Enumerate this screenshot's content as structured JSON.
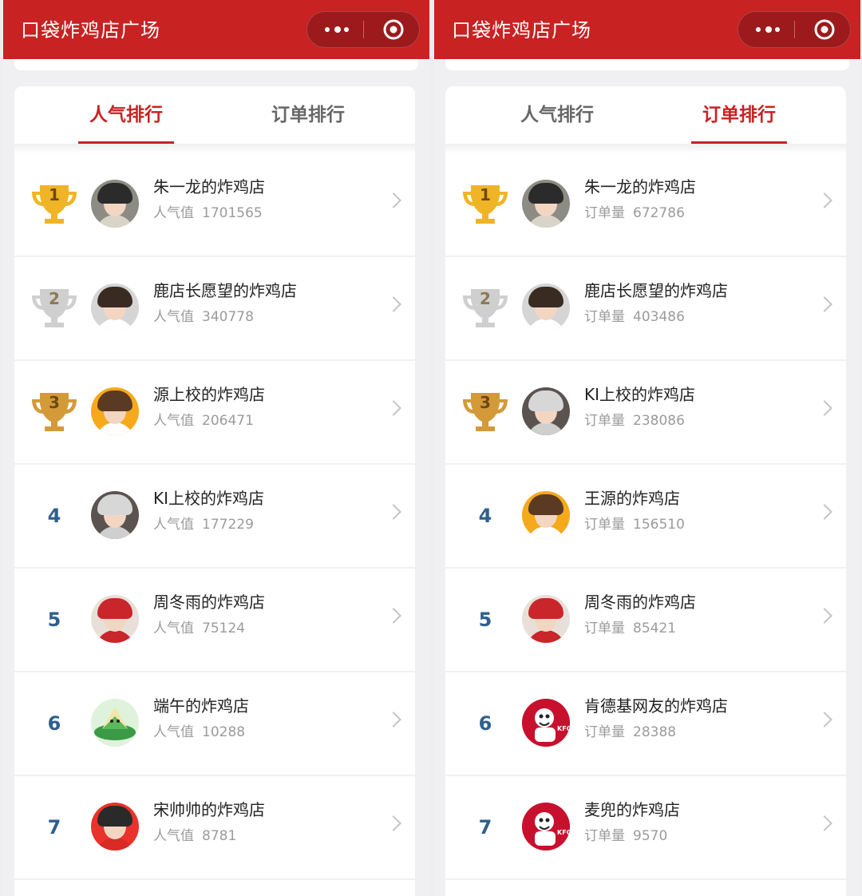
{
  "colors": {
    "brand": "#c82223",
    "gold": "#f0b427",
    "silver": "#cfcfcf",
    "bronze": "#d49a3a",
    "rank": "#2f5f8d"
  },
  "panels": [
    {
      "title": "口袋炸鸡店广场",
      "tabs": [
        {
          "label": "人气排行",
          "active": true
        },
        {
          "label": "订单排行",
          "active": false
        }
      ],
      "metric_label": "人气值",
      "rows": [
        {
          "rank": "1",
          "name": "朱一龙的炸鸡店",
          "value": "1701565",
          "avatar": "man-grey"
        },
        {
          "rank": "2",
          "name": "鹿店长愿望的炸鸡店",
          "value": "340778",
          "avatar": "man-glasses"
        },
        {
          "rank": "3",
          "name": "源上校的炸鸡店",
          "value": "206471",
          "avatar": "boy-yellow"
        },
        {
          "rank": "4",
          "name": "KI上校的炸鸡店",
          "value": "177229",
          "avatar": "robot"
        },
        {
          "rank": "5",
          "name": "周冬雨的炸鸡店",
          "value": "75124",
          "avatar": "girl-red"
        },
        {
          "rank": "6",
          "name": "端午的炸鸡店",
          "value": "10288",
          "avatar": "zongzi"
        },
        {
          "rank": "7",
          "name": "宋帅帅的炸鸡店",
          "value": "8781",
          "avatar": "man-red"
        }
      ]
    },
    {
      "title": "口袋炸鸡店广场",
      "tabs": [
        {
          "label": "人气排行",
          "active": false
        },
        {
          "label": "订单排行",
          "active": true
        }
      ],
      "metric_label": "订单量",
      "rows": [
        {
          "rank": "1",
          "name": "朱一龙的炸鸡店",
          "value": "672786",
          "avatar": "man-grey"
        },
        {
          "rank": "2",
          "name": "鹿店长愿望的炸鸡店",
          "value": "403486",
          "avatar": "man-glasses"
        },
        {
          "rank": "3",
          "name": "KI上校的炸鸡店",
          "value": "238086",
          "avatar": "robot"
        },
        {
          "rank": "4",
          "name": "王源的炸鸡店",
          "value": "156510",
          "avatar": "boy-yellow"
        },
        {
          "rank": "5",
          "name": "周冬雨的炸鸡店",
          "value": "85421",
          "avatar": "girl-red"
        },
        {
          "rank": "6",
          "name": "肯德基网友的炸鸡店",
          "value": "28388",
          "avatar": "kfc"
        },
        {
          "rank": "7",
          "name": "麦兜的炸鸡店",
          "value": "9570",
          "avatar": "kfc"
        }
      ]
    }
  ]
}
